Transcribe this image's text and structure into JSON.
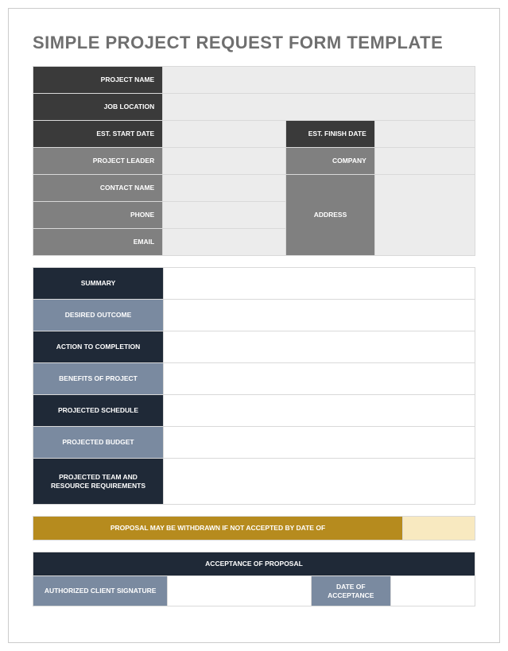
{
  "title": "SIMPLE PROJECT REQUEST FORM TEMPLATE",
  "section1": {
    "project_name": "PROJECT NAME",
    "job_location": "JOB LOCATION",
    "est_start_date": "EST. START DATE",
    "est_finish_date": "EST. FINISH DATE",
    "project_leader": "PROJECT LEADER",
    "company": "COMPANY",
    "contact_name": "CONTACT NAME",
    "phone": "PHONE",
    "email": "EMAIL",
    "address": "ADDRESS"
  },
  "section2": {
    "summary": "SUMMARY",
    "desired_outcome": "DESIRED OUTCOME",
    "action_to_completion": "ACTION TO COMPLETION",
    "benefits": "BENEFITS OF PROJECT",
    "projected_schedule": "PROJECTED SCHEDULE",
    "projected_budget": "PROJECTED BUDGET",
    "team_resource": "PROJECTED TEAM AND RESOURCE REQUIREMENTS"
  },
  "section3": {
    "withdraw_notice": "PROPOSAL MAY BE WITHDRAWN IF NOT ACCEPTED BY DATE OF"
  },
  "section4": {
    "header": "ACCEPTANCE OF PROPOSAL",
    "signature": "AUTHORIZED CLIENT SIGNATURE",
    "date_of_acceptance": "DATE OF ACCEPTANCE"
  }
}
